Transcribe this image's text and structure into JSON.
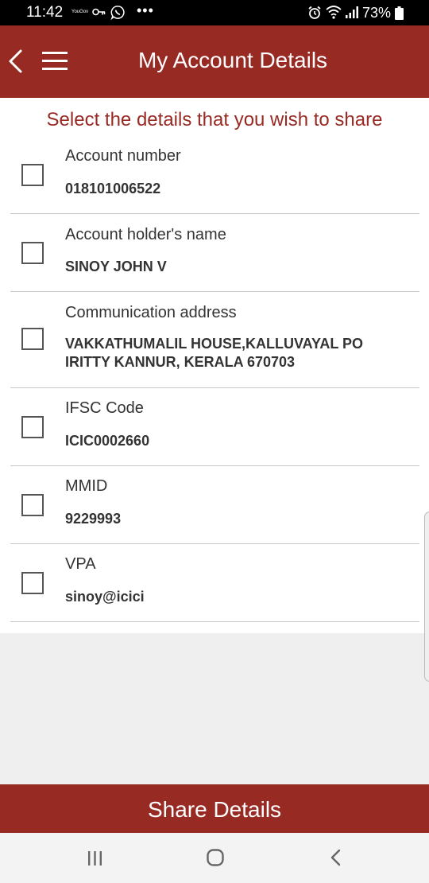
{
  "status_bar": {
    "time": "11:42",
    "tiny_text": "YouGov",
    "battery": "73%",
    "icons": [
      "key-icon",
      "whatsapp-icon",
      "more-dots-icon",
      "alarm-icon",
      "wifi-icon",
      "signal-icon",
      "battery-icon"
    ]
  },
  "app_bar": {
    "title": "My Account Details",
    "background": "#982a24",
    "icons": [
      "back-arrow-icon",
      "hamburger-menu-icon"
    ]
  },
  "instruction": "Select the details that you wish to share",
  "details": [
    {
      "label": "Account number",
      "value": "018101006522",
      "checked": false
    },
    {
      "label": "Account holder's name",
      "value": "SINOY JOHN V",
      "checked": false
    },
    {
      "label": "Communication address",
      "value_lines": [
        "VAKKATHUMALIL HOUSE,KALLUVAYAL PO",
        "IRITTY KANNUR, KERALA 670703"
      ],
      "checked": false
    },
    {
      "label": "IFSC Code",
      "value": "ICIC0002660",
      "checked": false
    },
    {
      "label": "MMID",
      "value": "9229993",
      "checked": false
    },
    {
      "label": "VPA",
      "value": "sinoy@icici",
      "checked": false
    }
  ],
  "share_button": {
    "label": "Share Details"
  },
  "nav_bar": {
    "icons": [
      "recents-icon",
      "home-icon",
      "back-icon"
    ]
  }
}
